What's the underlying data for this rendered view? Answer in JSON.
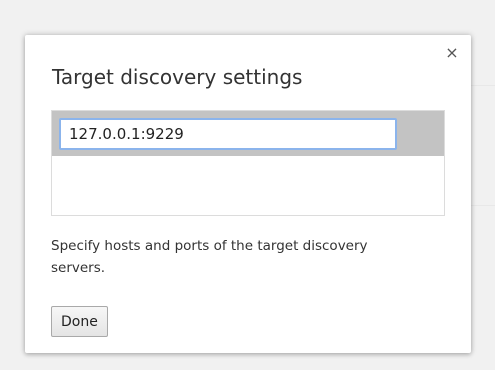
{
  "dialog": {
    "title": "Target discovery settings",
    "close_icon": "×",
    "hosts": [
      {
        "value": "127.0.0.1:9229"
      }
    ],
    "hint": "Specify hosts and ports of the target discovery servers.",
    "done_label": "Done"
  },
  "colors": {
    "selected_row": "#c3c3c3",
    "input_focus_border": "#8bb4ec"
  }
}
